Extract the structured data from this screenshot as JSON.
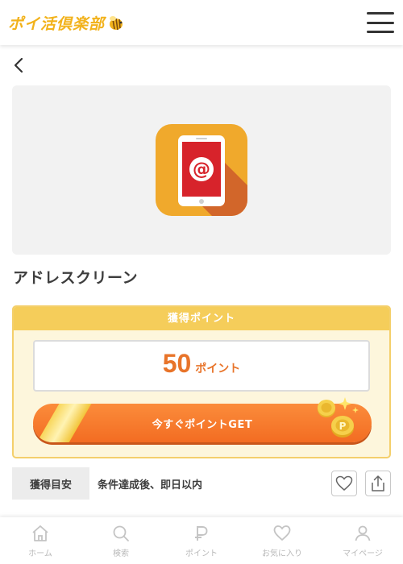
{
  "header": {
    "logo_text": "ポイ活倶楽部"
  },
  "app": {
    "title": "アドレスクリーン"
  },
  "points": {
    "head_label": "獲得ポイント",
    "value": "50",
    "unit": "ポイント",
    "button_label": "今すぐポイントGET"
  },
  "info": {
    "label": "獲得目安",
    "value": "条件達成後、即日以内"
  },
  "nav": [
    {
      "label": "ホーム",
      "icon": "home-icon"
    },
    {
      "label": "検索",
      "icon": "search-icon"
    },
    {
      "label": "ポイント",
      "icon": "point-icon"
    },
    {
      "label": "お気に入り",
      "icon": "heart-icon"
    },
    {
      "label": "マイページ",
      "icon": "user-icon"
    }
  ],
  "colors": {
    "accent_orange": "#f36c22",
    "accent_yellow": "#f5cd5a",
    "brand_logo": "#f2b21b"
  }
}
